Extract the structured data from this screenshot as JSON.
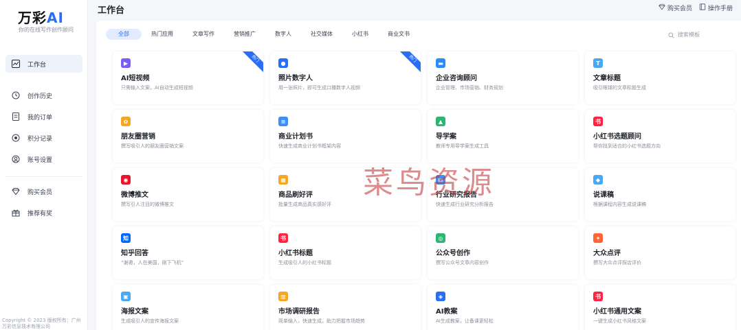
{
  "brand": {
    "logo_text": "万彩",
    "logo_ai": "AI",
    "tagline": "你的在线写作创作顾问"
  },
  "sidebar": {
    "items": [
      {
        "label": "工作台",
        "icon": "chart-line-icon",
        "active": true
      },
      {
        "label": "创作历史",
        "icon": "history-icon"
      },
      {
        "label": "我的订单",
        "icon": "order-icon"
      },
      {
        "label": "积分记录",
        "icon": "points-icon"
      },
      {
        "label": "账号设置",
        "icon": "account-icon"
      },
      {
        "label": "购买会员",
        "icon": "diamond-icon"
      },
      {
        "label": "推荐有奖",
        "icon": "gift-icon"
      }
    ],
    "copyright": "Copyright © 2023 版权所有：广州万彩信息技术有限公司"
  },
  "topbar": {
    "title": "工作台",
    "actions": [
      {
        "label": "购买会员",
        "icon": "diamond-icon"
      },
      {
        "label": "操作手册",
        "icon": "book-icon"
      }
    ]
  },
  "tabs": [
    "全部",
    "热门应用",
    "文章写作",
    "营销推广",
    "数字人",
    "社交媒体",
    "小红书",
    "商业文书"
  ],
  "search": {
    "placeholder": "搜索模板"
  },
  "cards": [
    {
      "title": "AI短视频",
      "desc": "只需输入文案，AI自动生成短视频",
      "icon": "video-icon",
      "icon_color": "#7b5cf5",
      "badge": "热门"
    },
    {
      "title": "照片数字人",
      "desc": "用一张照片，即可生成口播数字人视频",
      "icon": "avatar-icon",
      "icon_color": "#2b6ef6",
      "badge": "热门"
    },
    {
      "title": "企业咨询顾问",
      "desc": "企业管理、市场营销、财务规划",
      "icon": "consult-icon",
      "icon_color": "#2b8cf6"
    },
    {
      "title": "文章标题",
      "desc": "吸引眼球的文章标题生成",
      "icon": "title-icon",
      "icon_color": "#4aa8f0"
    },
    {
      "title": "朋友圈营销",
      "desc": "撰写吸引人的朋友圈营销文案",
      "icon": "moments-icon",
      "icon_color": "#f5a623"
    },
    {
      "title": "商业计划书",
      "desc": "快速生成商业计划书框架内容",
      "icon": "plan-icon",
      "icon_color": "#3f8df5"
    },
    {
      "title": "导学案",
      "desc": "教师专用导学案生成工具",
      "icon": "study-icon",
      "icon_color": "#2bb673"
    },
    {
      "title": "小红书选题顾问",
      "desc": "帮你找到适合的小红书选题方向",
      "icon": "xiaohongshu-icon",
      "icon_color": "#ff2442"
    },
    {
      "title": "微博推文",
      "desc": "撰写引人注目的微博推文",
      "icon": "weibo-icon",
      "icon_color": "#e6162d"
    },
    {
      "title": "商品刷好评",
      "desc": "批量生成商品真实感好评",
      "icon": "shop-icon",
      "icon_color": "#f5a623"
    },
    {
      "title": "行业研究报告",
      "desc": "快速生成行业研究分析报告",
      "icon": "report-icon",
      "icon_color": "#3f8df5"
    },
    {
      "title": "说课稿",
      "desc": "根据课程内容生成说课稿",
      "icon": "teacher-icon",
      "icon_color": "#4aa8f0"
    },
    {
      "title": "知乎回答",
      "desc": "“谢邀，人在美国，刚下飞机”",
      "icon": "zhihu-icon",
      "icon_color": "#0066ff"
    },
    {
      "title": "小红书标题",
      "desc": "生成吸引人的小红书标题",
      "icon": "xiaohongshu-icon",
      "icon_color": "#ff2442"
    },
    {
      "title": "公众号创作",
      "desc": "撰写公众号文章内容创作",
      "icon": "wechat-icon",
      "icon_color": "#2bb673"
    },
    {
      "title": "大众点评",
      "desc": "撰写大众点评探店评价",
      "icon": "dianping-icon",
      "icon_color": "#ff6633"
    },
    {
      "title": "海报文案",
      "desc": "生成吸引人的宣传海报文案",
      "icon": "poster-icon",
      "icon_color": "#4aa8f0"
    },
    {
      "title": "市场调研报告",
      "desc": "简单输入，快速生成，助力把握市场趋势",
      "icon": "research-icon",
      "icon_color": "#f5a623"
    },
    {
      "title": "AI教案",
      "desc": "AI生成教案，让备课更轻松",
      "icon": "lesson-icon",
      "icon_color": "#2b6ef6"
    },
    {
      "title": "小红书通用文案",
      "desc": "一键生成小红书风格文案",
      "icon": "xiaohongshu-icon",
      "icon_color": "#ff2442"
    }
  ],
  "watermark": "菜鸟资源"
}
